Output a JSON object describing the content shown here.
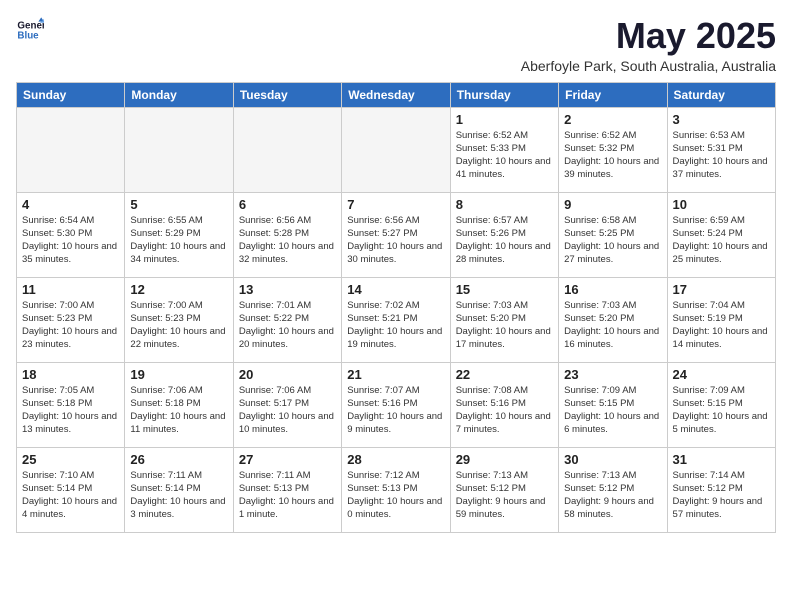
{
  "logo": {
    "line1": "General",
    "line2": "Blue"
  },
  "title": "May 2025",
  "subtitle": "Aberfoyle Park, South Australia, Australia",
  "days_of_week": [
    "Sunday",
    "Monday",
    "Tuesday",
    "Wednesday",
    "Thursday",
    "Friday",
    "Saturday"
  ],
  "weeks": [
    [
      {
        "day": "",
        "empty": true
      },
      {
        "day": "",
        "empty": true
      },
      {
        "day": "",
        "empty": true
      },
      {
        "day": "",
        "empty": true
      },
      {
        "day": "1",
        "info": "Sunrise: 6:52 AM\nSunset: 5:33 PM\nDaylight: 10 hours\nand 41 minutes."
      },
      {
        "day": "2",
        "info": "Sunrise: 6:52 AM\nSunset: 5:32 PM\nDaylight: 10 hours\nand 39 minutes."
      },
      {
        "day": "3",
        "info": "Sunrise: 6:53 AM\nSunset: 5:31 PM\nDaylight: 10 hours\nand 37 minutes."
      }
    ],
    [
      {
        "day": "4",
        "info": "Sunrise: 6:54 AM\nSunset: 5:30 PM\nDaylight: 10 hours\nand 35 minutes."
      },
      {
        "day": "5",
        "info": "Sunrise: 6:55 AM\nSunset: 5:29 PM\nDaylight: 10 hours\nand 34 minutes."
      },
      {
        "day": "6",
        "info": "Sunrise: 6:56 AM\nSunset: 5:28 PM\nDaylight: 10 hours\nand 32 minutes."
      },
      {
        "day": "7",
        "info": "Sunrise: 6:56 AM\nSunset: 5:27 PM\nDaylight: 10 hours\nand 30 minutes."
      },
      {
        "day": "8",
        "info": "Sunrise: 6:57 AM\nSunset: 5:26 PM\nDaylight: 10 hours\nand 28 minutes."
      },
      {
        "day": "9",
        "info": "Sunrise: 6:58 AM\nSunset: 5:25 PM\nDaylight: 10 hours\nand 27 minutes."
      },
      {
        "day": "10",
        "info": "Sunrise: 6:59 AM\nSunset: 5:24 PM\nDaylight: 10 hours\nand 25 minutes."
      }
    ],
    [
      {
        "day": "11",
        "info": "Sunrise: 7:00 AM\nSunset: 5:23 PM\nDaylight: 10 hours\nand 23 minutes."
      },
      {
        "day": "12",
        "info": "Sunrise: 7:00 AM\nSunset: 5:23 PM\nDaylight: 10 hours\nand 22 minutes."
      },
      {
        "day": "13",
        "info": "Sunrise: 7:01 AM\nSunset: 5:22 PM\nDaylight: 10 hours\nand 20 minutes."
      },
      {
        "day": "14",
        "info": "Sunrise: 7:02 AM\nSunset: 5:21 PM\nDaylight: 10 hours\nand 19 minutes."
      },
      {
        "day": "15",
        "info": "Sunrise: 7:03 AM\nSunset: 5:20 PM\nDaylight: 10 hours\nand 17 minutes."
      },
      {
        "day": "16",
        "info": "Sunrise: 7:03 AM\nSunset: 5:20 PM\nDaylight: 10 hours\nand 16 minutes."
      },
      {
        "day": "17",
        "info": "Sunrise: 7:04 AM\nSunset: 5:19 PM\nDaylight: 10 hours\nand 14 minutes."
      }
    ],
    [
      {
        "day": "18",
        "info": "Sunrise: 7:05 AM\nSunset: 5:18 PM\nDaylight: 10 hours\nand 13 minutes."
      },
      {
        "day": "19",
        "info": "Sunrise: 7:06 AM\nSunset: 5:18 PM\nDaylight: 10 hours\nand 11 minutes."
      },
      {
        "day": "20",
        "info": "Sunrise: 7:06 AM\nSunset: 5:17 PM\nDaylight: 10 hours\nand 10 minutes."
      },
      {
        "day": "21",
        "info": "Sunrise: 7:07 AM\nSunset: 5:16 PM\nDaylight: 10 hours\nand 9 minutes."
      },
      {
        "day": "22",
        "info": "Sunrise: 7:08 AM\nSunset: 5:16 PM\nDaylight: 10 hours\nand 7 minutes."
      },
      {
        "day": "23",
        "info": "Sunrise: 7:09 AM\nSunset: 5:15 PM\nDaylight: 10 hours\nand 6 minutes."
      },
      {
        "day": "24",
        "info": "Sunrise: 7:09 AM\nSunset: 5:15 PM\nDaylight: 10 hours\nand 5 minutes."
      }
    ],
    [
      {
        "day": "25",
        "info": "Sunrise: 7:10 AM\nSunset: 5:14 PM\nDaylight: 10 hours\nand 4 minutes."
      },
      {
        "day": "26",
        "info": "Sunrise: 7:11 AM\nSunset: 5:14 PM\nDaylight: 10 hours\nand 3 minutes."
      },
      {
        "day": "27",
        "info": "Sunrise: 7:11 AM\nSunset: 5:13 PM\nDaylight: 10 hours\nand 1 minute."
      },
      {
        "day": "28",
        "info": "Sunrise: 7:12 AM\nSunset: 5:13 PM\nDaylight: 10 hours\nand 0 minutes."
      },
      {
        "day": "29",
        "info": "Sunrise: 7:13 AM\nSunset: 5:12 PM\nDaylight: 9 hours\nand 59 minutes."
      },
      {
        "day": "30",
        "info": "Sunrise: 7:13 AM\nSunset: 5:12 PM\nDaylight: 9 hours\nand 58 minutes."
      },
      {
        "day": "31",
        "info": "Sunrise: 7:14 AM\nSunset: 5:12 PM\nDaylight: 9 hours\nand 57 minutes."
      }
    ]
  ]
}
